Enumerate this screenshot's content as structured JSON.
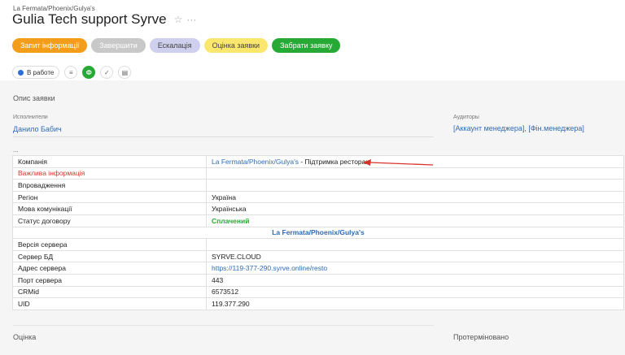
{
  "breadcrumb": "La Fermata/Phoenix/Gulya's",
  "title": "Gulia Tech support Syrve",
  "icons": {
    "star": "star-icon",
    "more": "more-icon"
  },
  "actions": [
    {
      "label": "Запит інформації",
      "color": "#f49d1b"
    },
    {
      "label": "Завершити",
      "color": "#c8c8c8"
    },
    {
      "label": "Ескалація",
      "color": "#cfcfee"
    },
    {
      "label": "Оцінка заявки",
      "color": "#fbe66e"
    },
    {
      "label": "Забрати заявку",
      "color": "#27a936"
    }
  ],
  "status": {
    "label": "В работе",
    "color": "#2a6ed6"
  },
  "tools": {
    "avatar_letter": "Ф"
  },
  "description": {
    "section_title": "Опис заявки",
    "executors_label": "Исполнители",
    "executor": "Данило Бабич",
    "auditors_label": "Аудиторы",
    "auditors": "[Аккаунт менеджера], [Фін.менеджера]",
    "ellipsis": "..."
  },
  "table": {
    "rows": [
      {
        "label": "Компанія",
        "value_link": "La Fermata/Phoenix/Gulya's",
        "value_text": " - Підтримка ресторан"
      },
      {
        "label": "Важлива інформація",
        "value": ""
      },
      {
        "label": "Впровадження",
        "value": ""
      },
      {
        "label": "Регіон",
        "value": "Україна"
      },
      {
        "label": "Мова комунікації",
        "value": "Українська"
      },
      {
        "label": "Статус договору",
        "value": "Сплачений"
      },
      {
        "label": "",
        "value": "La Fermata/Phoenix/Gulya's"
      },
      {
        "label": "Версія сервера",
        "value": ""
      },
      {
        "label": "Сервер БД",
        "value": "SYRVE.CLOUD"
      },
      {
        "label": "Адрес сервера",
        "value": "https://119-377-290.syrve.online/resto"
      },
      {
        "label": "Порт сервера",
        "value": "443"
      },
      {
        "label": "CRMid",
        "value": "6573512"
      },
      {
        "label": "UID",
        "value": "119.377.290"
      }
    ]
  },
  "footer": {
    "left": "Оцінка",
    "right": "Протерміновано"
  }
}
